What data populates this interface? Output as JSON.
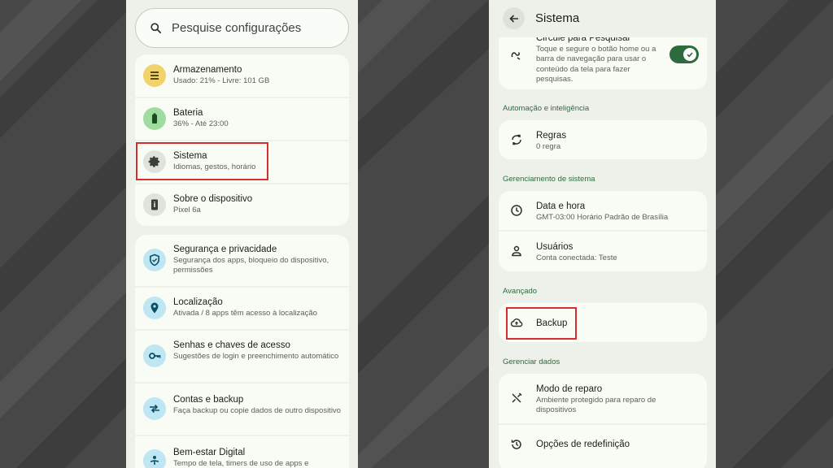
{
  "left": {
    "search_placeholder": "Pesquise configurações",
    "items": [
      {
        "title": "Armazenamento",
        "subtitle": "Usado: 21% - Livre: 101 GB",
        "icon": "storage-icon"
      },
      {
        "title": "Bateria",
        "subtitle": "36% - Até 23:00",
        "icon": "battery-icon"
      },
      {
        "title": "Sistema",
        "subtitle": "Idiomas, gestos, horário",
        "icon": "gear-icon"
      },
      {
        "title": "Sobre o dispositivo",
        "subtitle": "Pixel 6a",
        "icon": "phone-info-icon"
      },
      {
        "title": "Segurança e privacidade",
        "subtitle": "Segurança dos apps, bloqueio do dispositivo, permissões",
        "icon": "shield-icon"
      },
      {
        "title": "Localização",
        "subtitle": "Ativada / 8 apps têm acesso à localização",
        "icon": "location-pin-icon"
      },
      {
        "title": "Senhas e chaves de acesso",
        "subtitle": "Sugestões de login e preenchimento automático",
        "icon": "key-icon"
      },
      {
        "title": "Contas e backup",
        "subtitle": "Faça backup ou copie dados de outro dispositivo",
        "icon": "sync-arrows-icon"
      },
      {
        "title": "Bem-estar Digital",
        "subtitle": "Tempo de tela, timers de uso de apps e",
        "icon": "wellbeing-icon"
      }
    ]
  },
  "right": {
    "page_title": "Sistema",
    "circle": {
      "title": "Circule para Pesquisar",
      "subtitle": "Toque e segure o botão home ou a barra de navegação para usar o conteúdo da tela para fazer pesquisas.",
      "toggle_on": true
    },
    "sections": {
      "automation": "Automação e inteligência",
      "management": "Gerenciamento de sistema",
      "advanced": "Avançado",
      "data": "Gerenciar dados"
    },
    "rules": {
      "title": "Regras",
      "subtitle": "0 regra"
    },
    "datetime": {
      "title": "Data e hora",
      "subtitle": "GMT-03:00 Horário Padrão de Brasília"
    },
    "users": {
      "title": "Usuários",
      "subtitle": "Conta conectada: Teste"
    },
    "backup": {
      "title": "Backup"
    },
    "repair": {
      "title": "Modo de reparo",
      "subtitle": "Ambiente protegido para reparo de dispositivos"
    },
    "reset": {
      "title": "Opções de redefinição"
    }
  },
  "colors": {
    "accent_green": "#2d6a3c",
    "highlight_red": "#d62d2d"
  }
}
